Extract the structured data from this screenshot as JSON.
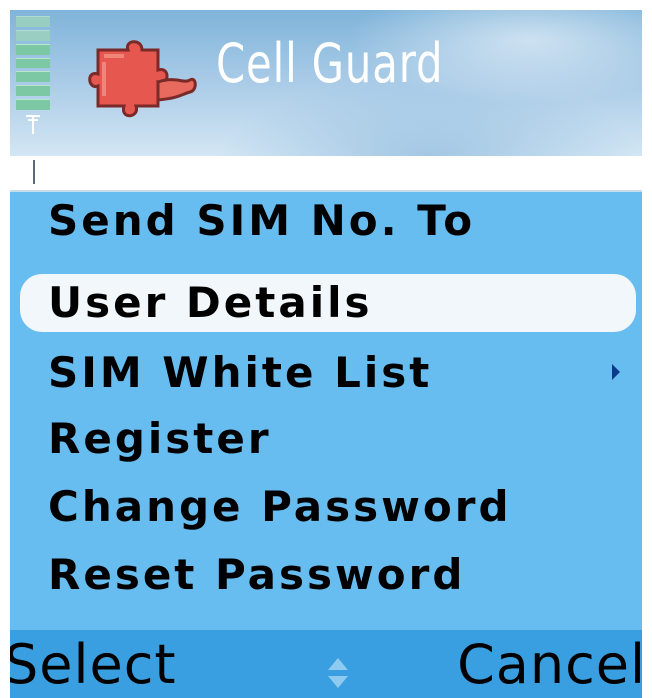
{
  "header": {
    "title": "Cell Guard",
    "icon": "puzzle-piece-icon"
  },
  "status": {
    "signal_bars": 7,
    "signal_icon": "antenna-icon"
  },
  "menu": {
    "items": [
      {
        "label": "Send SIM No. To",
        "selected": false,
        "has_submenu": false
      },
      {
        "label": "User Details",
        "selected": true,
        "has_submenu": false
      },
      {
        "label": "SIM White List",
        "selected": false,
        "has_submenu": true
      },
      {
        "label": "Register",
        "selected": false,
        "has_submenu": false
      },
      {
        "label": "Change Password",
        "selected": false,
        "has_submenu": false
      },
      {
        "label": "Reset Password",
        "selected": false,
        "has_submenu": false
      }
    ]
  },
  "softkeys": {
    "left": "Select",
    "right": "Cancel",
    "scroll_icon": "scroll-up-down-icon"
  },
  "colors": {
    "menu_bg": "#68bdf0",
    "softkey_bg": "#3a9fe0",
    "selection": "#f2f7fb",
    "icon_red": "#e5574f"
  }
}
